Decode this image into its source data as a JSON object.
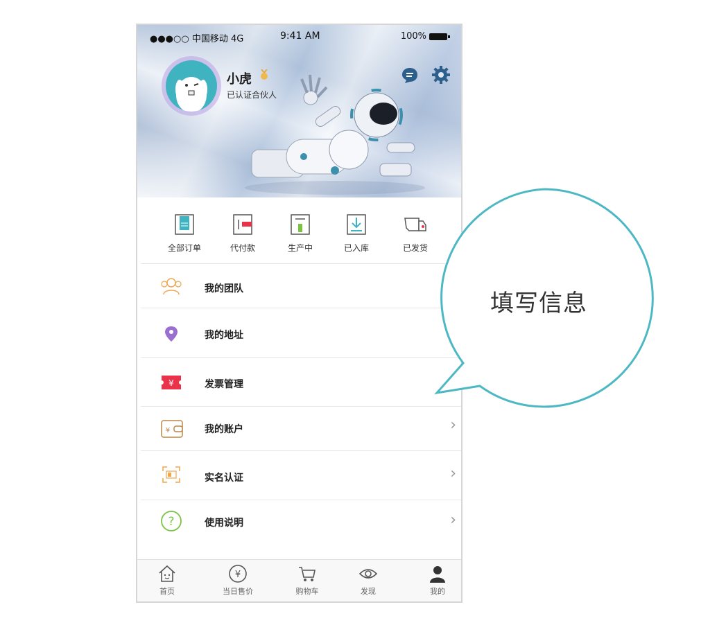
{
  "status_bar": {
    "carrier": "●●●○○ 中国移动 4G",
    "time": "9:41 AM",
    "battery": "100%"
  },
  "profile": {
    "name": "小虎",
    "subtitle": "已认证合伙人"
  },
  "orders": [
    {
      "label": "全部订单",
      "icon": "all-orders-icon"
    },
    {
      "label": "代付款",
      "icon": "pending-payment-icon"
    },
    {
      "label": "生产中",
      "icon": "in-production-icon"
    },
    {
      "label": "已入库",
      "icon": "in-stock-icon"
    },
    {
      "label": "已发货",
      "icon": "shipped-truck-icon"
    }
  ],
  "menu": [
    {
      "label": "我的团队",
      "icon": "team-icon"
    },
    {
      "label": "我的地址",
      "icon": "location-pin-icon"
    },
    {
      "label": "发票管理",
      "icon": "invoice-ticket-icon"
    },
    {
      "label": "我的账户",
      "icon": "wallet-icon"
    },
    {
      "label": "实名认证",
      "icon": "id-scan-icon"
    },
    {
      "label": "使用说明",
      "icon": "help-icon"
    }
  ],
  "tabbar": [
    {
      "label": "首页",
      "icon": "home-icon"
    },
    {
      "label": "当日售价",
      "icon": "yuan-icon"
    },
    {
      "label": "购物车",
      "icon": "cart-icon"
    },
    {
      "label": "发现",
      "icon": "eye-icon"
    },
    {
      "label": "我的",
      "icon": "person-icon"
    }
  ],
  "callout": {
    "text": "填写信息"
  },
  "colors": {
    "accent_teal": "#4db8c4",
    "invoice_red": "#e8334a",
    "purple": "#9b6fd0",
    "green": "#7bc242",
    "gold": "#c99a3b"
  }
}
